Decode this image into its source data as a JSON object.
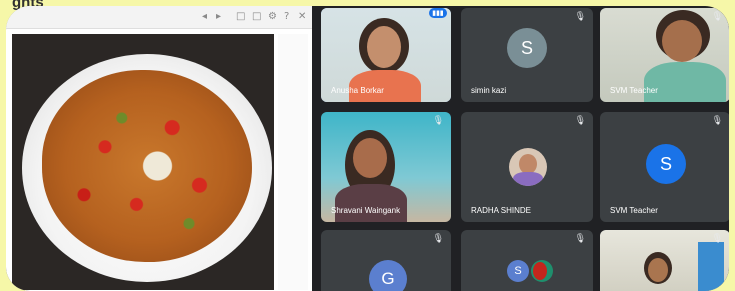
{
  "caption": "ghts",
  "share": {
    "toolbar_icons": [
      "◂",
      "▸",
      "□",
      "□",
      "⚙",
      "?",
      "✕"
    ]
  },
  "tiles": [
    {
      "name": "Anusha Borkar",
      "type": "video",
      "active": true,
      "mic_icon": "mic-active-icon"
    },
    {
      "name": "simin kazi",
      "type": "avatar",
      "initial": "S",
      "avatar_color": "#7a8f96",
      "mic_icon": "mic-off-icon"
    },
    {
      "name": "SVM Teacher",
      "type": "video",
      "mic_icon": "mic-off-icon"
    },
    {
      "name": "Shravani Waingank",
      "type": "video",
      "mic_icon": "mic-off-icon"
    },
    {
      "name": "RADHA SHINDE",
      "type": "photo-avatar",
      "mic_icon": "mic-off-icon"
    },
    {
      "name": "SVM Teacher",
      "type": "avatar",
      "initial": "S",
      "avatar_color": "#1a73e8",
      "mic_icon": "mic-off-icon"
    },
    {
      "name": "",
      "type": "avatar",
      "initial": "G",
      "avatar_color": "#5b7fcf",
      "mic_icon": "mic-off-icon"
    },
    {
      "name": "",
      "type": "dual-avatar",
      "initial": "S",
      "avatar_color": "#5b7fcf",
      "mic_icon": "mic-off-icon"
    },
    {
      "name": "",
      "type": "video",
      "mic_icon": "mic-off-icon"
    }
  ],
  "icons": {
    "mic_active": "▮▮▮",
    "mic_off": "🎙"
  }
}
